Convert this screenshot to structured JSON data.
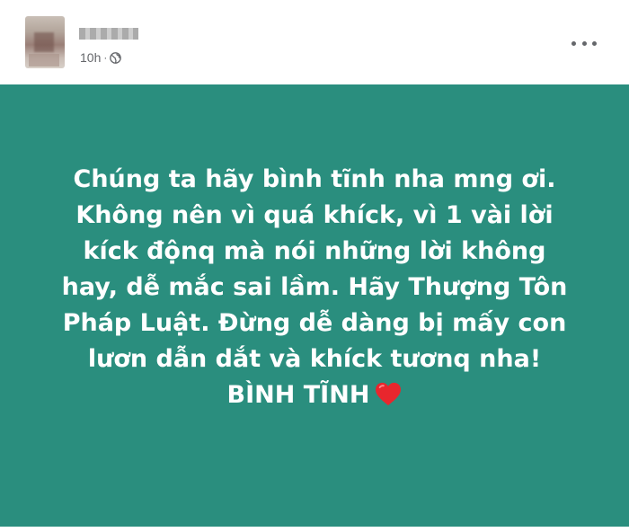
{
  "post": {
    "timestamp": "10h",
    "separator": "·",
    "visibility_icon": "globe-icon",
    "more_icon": "more-options-icon",
    "background_color": "#2a8e7e",
    "text_color": "#ffffff",
    "lines": [
      "Chúng ta hãy bình tĩnh nha mng ơi.",
      "Không nên vì quá khíck, vì 1 vài lời",
      "kíck độnq mà nói những lời không",
      "hay, dễ mắc sai lầm. Hãy Thượng Tôn",
      "Pháp Luật. Đừng dễ dàng bị mấy con",
      "lươn dẫn dắt và khíck tươnq nha!",
      "BÌNH TĨNH"
    ],
    "end_emoji": "heart-icon",
    "heart_color": "#e8262d"
  }
}
